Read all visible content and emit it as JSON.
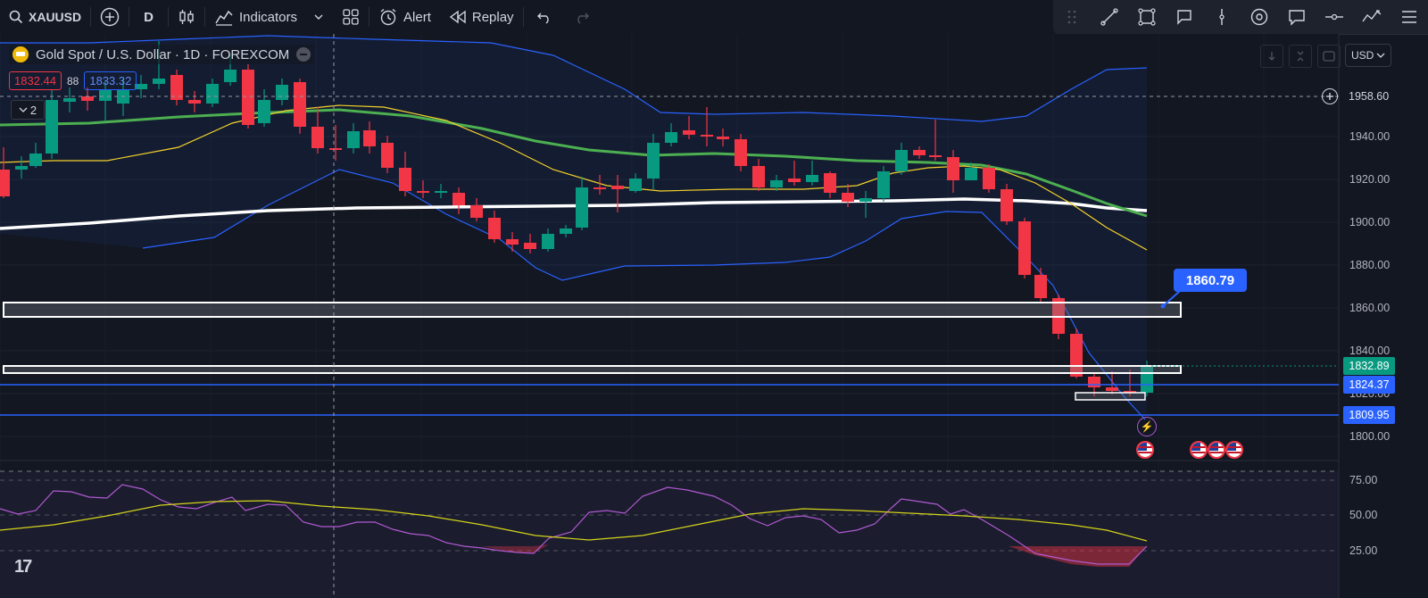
{
  "toolbar": {
    "symbol": "XAUUSD",
    "interval": "D",
    "indicators_label": "Indicators",
    "alert_label": "Alert",
    "replay_label": "Replay"
  },
  "legend": {
    "title": "Gold Spot / U.S. Dollar · 1D · FOREXCOM",
    "sell_price": "1832.44",
    "spread": "88",
    "buy_price": "1833.32",
    "collapsed_count": "2"
  },
  "axis": {
    "currency": "USD",
    "ticks": [
      "1940.00",
      "1920.00",
      "1900.00",
      "1880.00",
      "1860.00",
      "1840.00",
      "1820.00",
      "1800.00"
    ],
    "labels": {
      "high": "1958.60",
      "last": "1832.89",
      "line1": "1824.37",
      "line2": "1809.95"
    },
    "rsi_ticks": [
      "75.00",
      "50.00",
      "25.00"
    ]
  },
  "callout_value": "1860.79",
  "colors": {
    "background": "#131722",
    "up": "#089981",
    "down": "#f23645",
    "ma_white": "#ffffff",
    "ma_green": "#4caf50",
    "ma_yellow": "#f5d22c",
    "bollinger": "#2962ff",
    "rsi": "#b05ad1",
    "rsi_ma": "#d4d41a",
    "accent": "#2962ff"
  },
  "icons": [
    "search-icon",
    "add-symbol-icon",
    "candles-icon",
    "indicators-icon",
    "layout-icon",
    "alert-icon",
    "replay-icon",
    "undo-icon",
    "redo-icon",
    "trendline-icon",
    "rectangle-icon",
    "callout-icon",
    "vertical-line-icon",
    "target-icon",
    "comment-icon",
    "position-icon",
    "wave-icon",
    "menu-icon"
  ]
}
